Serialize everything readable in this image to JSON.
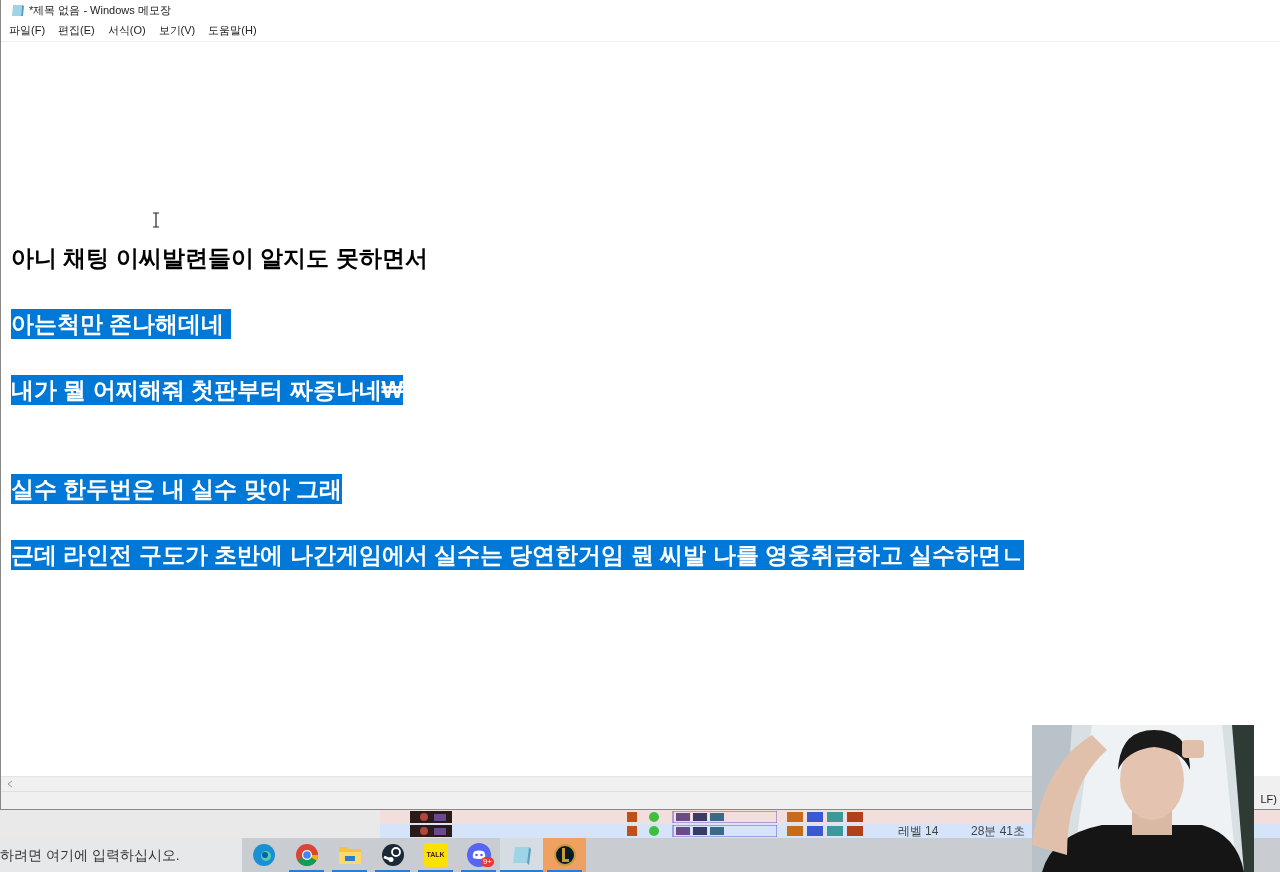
{
  "window": {
    "title": "*제목 없음 - Windows 메모장"
  },
  "menu": [
    "파일(F)",
    "편집(E)",
    "서식(O)",
    "보기(V)",
    "도움말(H)"
  ],
  "lines": [
    {
      "kind": "blank"
    },
    {
      "kind": "blank"
    },
    {
      "kind": "blank"
    },
    {
      "kind": "blank"
    },
    {
      "kind": "blank"
    },
    {
      "kind": "blank"
    },
    {
      "kind": "text",
      "text": "아니 채팅 이씨발련들이 알지도 못하면서",
      "selected": false
    },
    {
      "kind": "blank"
    },
    {
      "kind": "text",
      "text": "아는척만 존나해데네 ",
      "selected": true
    },
    {
      "kind": "blank"
    },
    {
      "kind": "text",
      "text": "내가 뭘 어찌해줘 첫판부터 짜증나네₩",
      "selected": true
    },
    {
      "kind": "blank"
    },
    {
      "kind": "blank"
    },
    {
      "kind": "text",
      "text": "실수 한두번은 내 실수 맞아 그래",
      "selected": true
    },
    {
      "kind": "blank"
    },
    {
      "kind": "text",
      "text": "근데 라인전 구도가 초반에 나간게임에서 실수는 당연한거임 뭔 씨발 나를 영웅취급하고 실수하면ㄴ",
      "selected": true
    }
  ],
  "status_bar": {
    "text": "LF)"
  },
  "background_table": {
    "rows": [
      {
        "selected": false
      },
      {
        "selected": true,
        "column_6": "레벨 14",
        "column_7": "28분 41초"
      }
    ]
  },
  "taskbar": {
    "search_placeholder": "하려면 여기에 입력하십시오.",
    "apps": [
      {
        "kind": "edge",
        "running": false,
        "focused": false,
        "flashing": false
      },
      {
        "kind": "chrome",
        "running": true,
        "focused": false,
        "flashing": false
      },
      {
        "kind": "folder",
        "running": true,
        "focused": false,
        "flashing": false
      },
      {
        "kind": "steam",
        "running": true,
        "focused": false,
        "flashing": false
      },
      {
        "kind": "kakao",
        "running": true,
        "focused": false,
        "flashing": false,
        "label": "TALK"
      },
      {
        "kind": "discord",
        "running": true,
        "focused": false,
        "flashing": false,
        "badge": "9+"
      },
      {
        "kind": "notepad",
        "running": true,
        "focused": true,
        "flashing": false
      },
      {
        "kind": "league",
        "running": true,
        "focused": false,
        "flashing": true
      }
    ]
  }
}
